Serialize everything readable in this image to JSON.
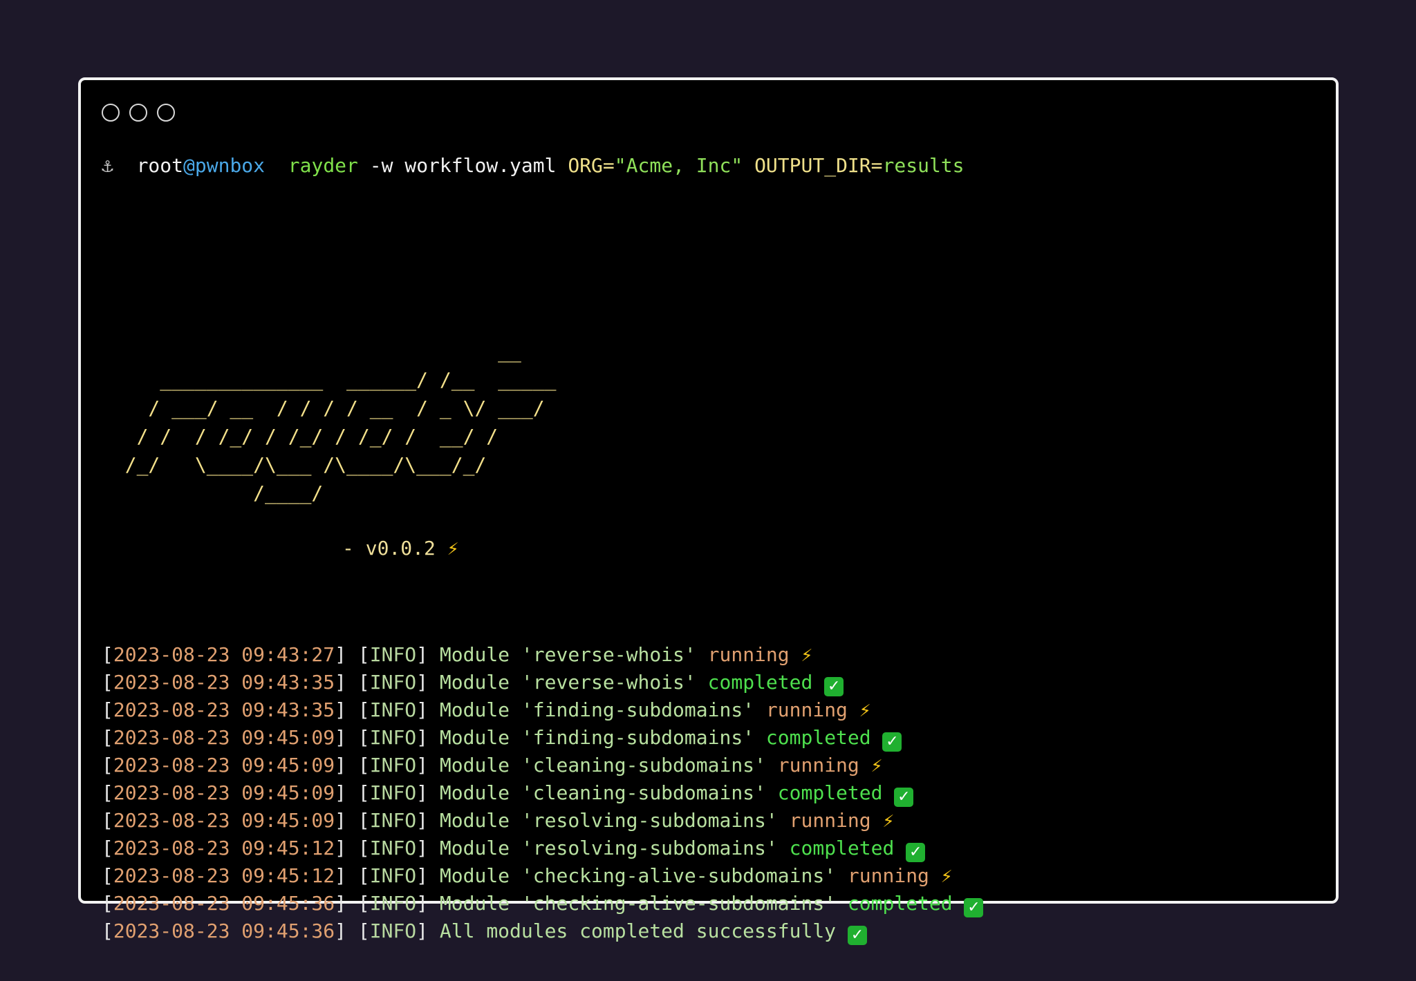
{
  "window": {
    "controls": [
      "close",
      "minimize",
      "maximize"
    ]
  },
  "prompt": {
    "icon": "⚓",
    "user": "root",
    "host": "@pwnbox",
    "command": "rayder",
    "args": " -w workflow.yaml ",
    "org_key": "ORG=",
    "org_value": "\"Acme, Inc\"",
    "out_key": " OUTPUT_DIR=",
    "out_value": "results"
  },
  "banner": {
    "art": "                                  __\n     ______________  ______/ /__  _____\n    / ___/ __  / / / / __  / _ \\/ ___/\n   / /  / /_/ / /_/ / /_/ /  __/ /\n  /_/   \\____/\\___ /\\____/\\___/_/\n             /____/",
    "version": "- v0.0.2",
    "version_icon": "⚡"
  },
  "log": {
    "lines": [
      {
        "ts": "2023-08-23 09:43:27",
        "level": "INFO",
        "msg": "Module 'reverse-whois'",
        "status": "running",
        "kind": "running"
      },
      {
        "ts": "2023-08-23 09:43:35",
        "level": "INFO",
        "msg": "Module 'reverse-whois'",
        "status": "completed",
        "kind": "completed"
      },
      {
        "ts": "2023-08-23 09:43:35",
        "level": "INFO",
        "msg": "Module 'finding-subdomains'",
        "status": "running",
        "kind": "running"
      },
      {
        "ts": "2023-08-23 09:45:09",
        "level": "INFO",
        "msg": "Module 'finding-subdomains'",
        "status": "completed",
        "kind": "completed"
      },
      {
        "ts": "2023-08-23 09:45:09",
        "level": "INFO",
        "msg": "Module 'cleaning-subdomains'",
        "status": "running",
        "kind": "running"
      },
      {
        "ts": "2023-08-23 09:45:09",
        "level": "INFO",
        "msg": "Module 'cleaning-subdomains'",
        "status": "completed",
        "kind": "completed"
      },
      {
        "ts": "2023-08-23 09:45:09",
        "level": "INFO",
        "msg": "Module 'resolving-subdomains'",
        "status": "running",
        "kind": "running"
      },
      {
        "ts": "2023-08-23 09:45:12",
        "level": "INFO",
        "msg": "Module 'resolving-subdomains'",
        "status": "completed",
        "kind": "completed"
      },
      {
        "ts": "2023-08-23 09:45:12",
        "level": "INFO",
        "msg": "Module 'checking-alive-subdomains'",
        "status": "running",
        "kind": "running"
      },
      {
        "ts": "2023-08-23 09:45:36",
        "level": "INFO",
        "msg": "Module 'checking-alive-subdomains'",
        "status": "completed",
        "kind": "completed"
      },
      {
        "ts": "2023-08-23 09:45:36",
        "level": "INFO",
        "msg": "All modules completed successfully",
        "status": "",
        "kind": "final"
      }
    ]
  }
}
